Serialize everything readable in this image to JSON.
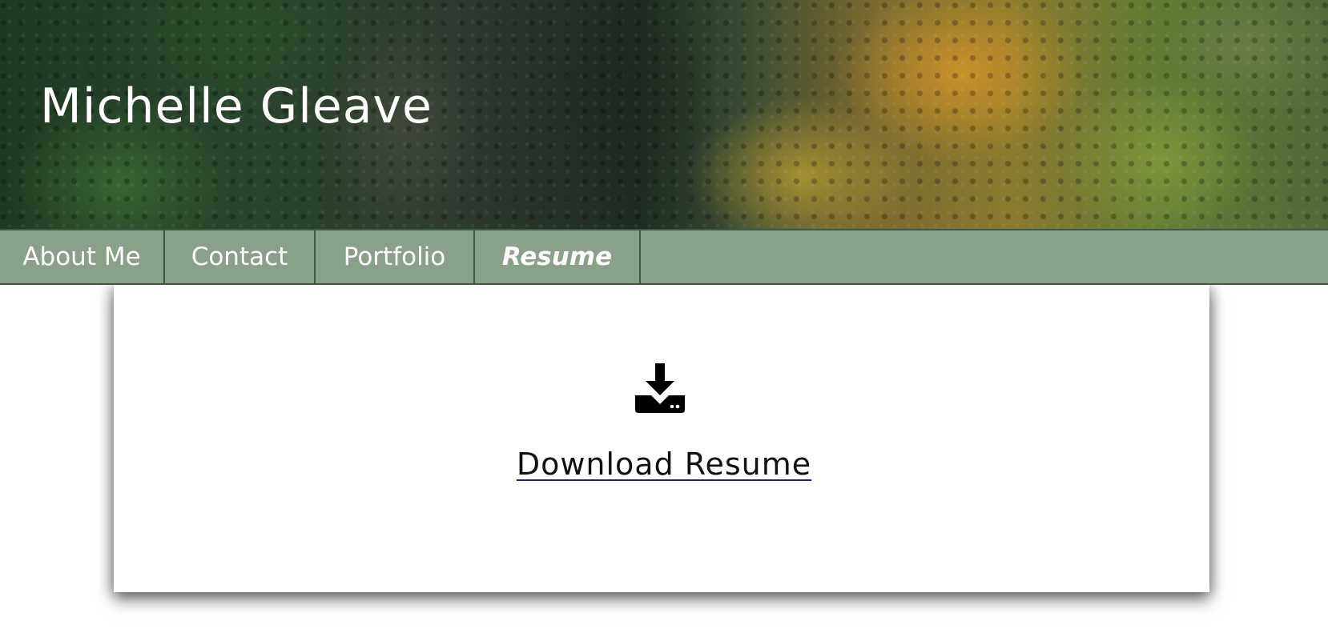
{
  "header": {
    "title": "Michelle Gleave"
  },
  "nav": {
    "items": [
      {
        "label": "About Me",
        "active": false
      },
      {
        "label": "Contact",
        "active": false
      },
      {
        "label": "Portfolio",
        "active": false
      },
      {
        "label": "Resume",
        "active": true
      }
    ]
  },
  "main": {
    "download_icon": "download-tray-icon",
    "download_label": "Download Resume"
  },
  "colors": {
    "nav_bg": "#88a188",
    "nav_border": "#3f5840",
    "link_underline": "#1a1ab0"
  }
}
